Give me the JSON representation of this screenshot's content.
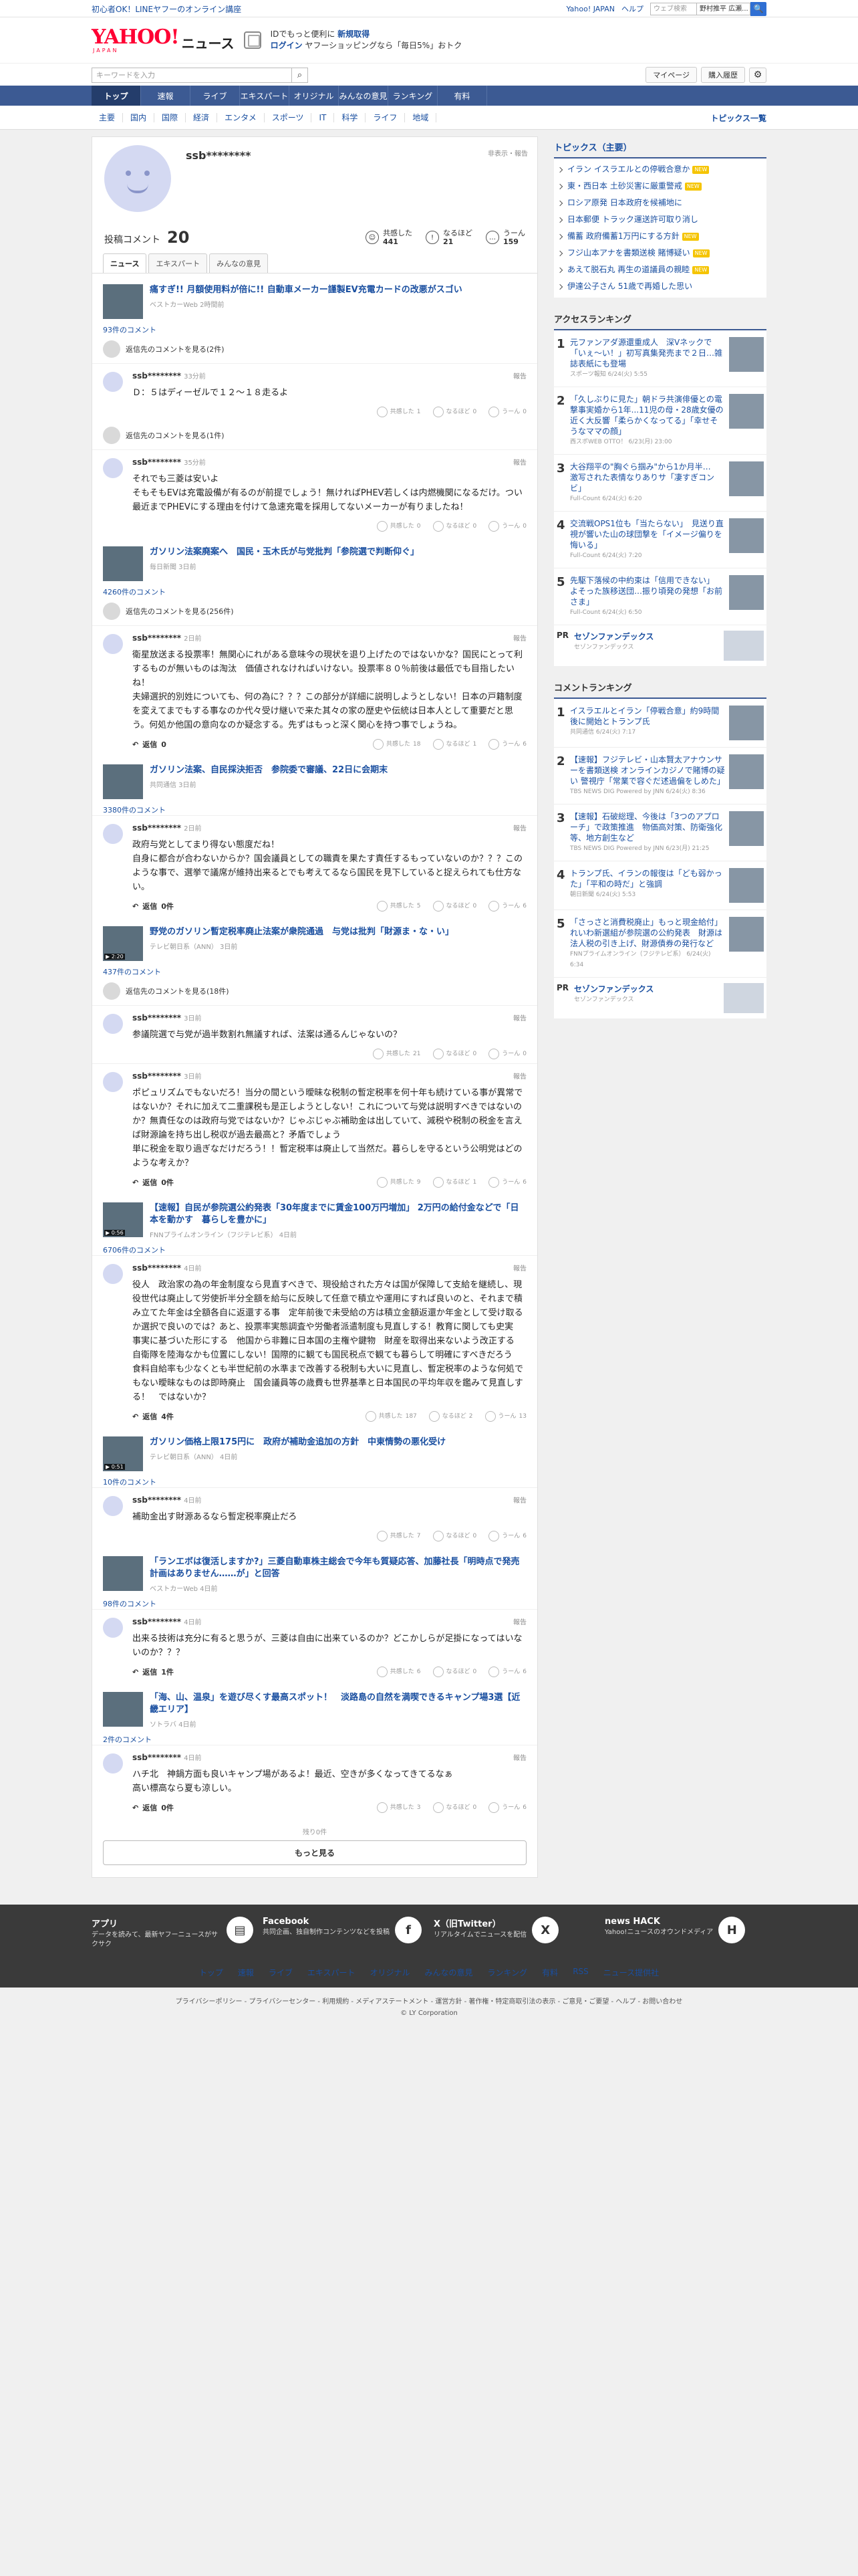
{
  "topbar": {
    "promo": "初心者OK！LINEヤフーのオンライン講座",
    "yahoo": "Yahoo! JAPAN",
    "help": "ヘルプ",
    "search_ph": "ウェブ検索",
    "loc": "野村推平 広瀬...",
    "btn": "🔍"
  },
  "header": {
    "logo": "YAHOO!",
    "logo_sub": "JAPAN",
    "service": "ニュース",
    "login_line1a": "IDでもっと便利に",
    "login_line1b": "新規取得",
    "login": "ログイン",
    "login_line2": "ヤフーショッピングなら「毎日5%」おトク"
  },
  "search": {
    "placeholder": "キーワードを入力",
    "mypage": "マイページ",
    "purchase": "購入履歴"
  },
  "gnav": [
    "トップ",
    "速報",
    "ライブ",
    "エキスパート",
    "オリジナル",
    "みんなの意見",
    "ランキング",
    "有料"
  ],
  "cnav": {
    "items": [
      "主要",
      "国内",
      "国際",
      "経済",
      "エンタメ",
      "スポーツ",
      "IT",
      "科学",
      "ライフ",
      "地域"
    ],
    "topics": "トピックス一覧"
  },
  "profile": {
    "name": "ssb********",
    "badge": "非表示・報告",
    "comment_label": "投稿コメント",
    "comment_count": "20",
    "r1": "共感した",
    "r1v": "441",
    "r2": "なるほど",
    "r2v": "21",
    "r3": "うーん",
    "r3v": "159"
  },
  "tabs": [
    "ニュース",
    "エキスパート",
    "みんなの意見"
  ],
  "ui": {
    "reply": "返信",
    "report": "報告",
    "empathy": "共感した",
    "naruhodo": "なるほど",
    "un": "うーん",
    "remaining": "残り0件",
    "more": "もっと見る"
  },
  "articles": [
    {
      "title": "痛すぎ!! 月額使用料が倍に!! 自動車メーカー謹製EV充電カードの改悪がスゴい",
      "src": "ベストカーWeb 2時間前",
      "count": "93件のコメント",
      "reply1": "返信先のコメントを見る(2件)",
      "comments": [
        {
          "user": "ssb********",
          "time": "33分前",
          "text": "Ｄ：５はディーゼルで１２～１８走るよ",
          "a": "1",
          "b": "0",
          "c": "0",
          "rep": ""
        }
      ],
      "reply2": "返信先のコメントを見る(1件)",
      "comments2": [
        {
          "user": "ssb********",
          "time": "35分前",
          "text": "それでも三菱は安いよ\nそもそもEVは充電設備が有るのが前提でしょう！無ければPHEV若しくは内燃機関になるだけ。つい最近までPHEVにする理由を付けて急速充電を採用してないメーカーが有りましたね！",
          "a": "0",
          "b": "0",
          "c": "0",
          "rep": ""
        }
      ]
    },
    {
      "title": "ガソリン法案廃案へ　国民・玉木氏が与党批判「参院選で判断仰ぐ」",
      "src": "毎日新聞 3日前",
      "count": "4260件のコメント",
      "reply1": "返信先のコメントを見る(256件)",
      "comments": [
        {
          "user": "ssb********",
          "time": "2日前",
          "text": "衛星放送まる投票率！無関心にれがある意味今の現状を退り上げたのではないかな？国民にとって利するものが無いものは淘汰　価値されなければいけない。投票率８０％前後は最低でも目指したいね！\n夫婦選択的別姓についても、何の為に？？？この部分が詳細に説明しようとしない！日本の戸籍制度を変えてまでもする事なのか代々受け継いで来た其々の家の歴史や伝統は日本人として重要だと思う。何処か他国の意向なのか疑念する。先ずはもっと深く関心を持つ事でしょうね。",
          "a": "18",
          "b": "1",
          "c": "6",
          "rep": "0"
        }
      ]
    },
    {
      "title": "ガソリン法案、自民採決拒否　参院委で審議、22日に会期末",
      "src": "共同通信 3日前",
      "count": "3380件のコメント",
      "comments": [
        {
          "user": "ssb********",
          "time": "2日前",
          "text": "政府与党としてまり得ない態度だね！\n自身に都合が合わないからか？国会議員としての職責を果たす責任するもっていないのか？？？このような事で、選挙で議席が維持出来るとでも考えてるなら国民を見下していると捉えられても仕方ない。",
          "a": "5",
          "b": "0",
          "c": "6",
          "rep": "0件"
        }
      ]
    },
    {
      "title": "野党のガソリン暫定税率廃止法案が衆院通過　与党は批判「財源ま・な・い」",
      "src": "テレビ朝日系（ANN） 3日前",
      "count": "437件のコメント",
      "reply1": "返信先のコメントを見る(18件)",
      "dur": "▶ 2:20",
      "comments": [
        {
          "user": "ssb********",
          "time": "3日前",
          "text": "参議院選で与党が過半数割れ無議すれば、法案は通るんじゃないの？",
          "a": "21",
          "b": "0",
          "c": "0",
          "rep": ""
        },
        {
          "user": "ssb********",
          "time": "3日前",
          "text": "ポピュリズムでもないだろ！当分の間という曖昧な税制の暫定税率を何十年も続けている事が異常ではないか？それに加えて二重課税も是正しようとしない！これについて与党は説明すべきではないのか？無責任なのは政府与党ではないか？じゃぶじゃぶ補助金は出していて、減税や税制の税金を言えば財源論を持ち出し税収が過去最高と？矛盾でしょう\n単に税金を取り過ぎなだけだろう！！暫定税率は廃止して当然だ。暮らしを守るという公明党はどのような考えか？",
          "a": "9",
          "b": "1",
          "c": "6",
          "rep": "0件"
        }
      ]
    },
    {
      "title": "【速報】自民が参院選公約発表「30年度までに賃金100万円増加」 2万円の給付金などで「日本を動かす　暮らしを豊かに」",
      "src": "FNNプライムオンライン（フジテレビ系） 4日前",
      "count": "6706件のコメント",
      "dur": "▶ 0:56",
      "comments": [
        {
          "user": "ssb********",
          "time": "4日前",
          "text": "役人　政治家の為の年金制度なら見直すべきで、現役給された方々は国が保障して支給を継続し、現役世代は廃止して労使折半分全額を給与に反映して任意で積立や運用にすれば良いのと、それまで積み立てた年金は全額各自に返還する事　定年前後で未受給の方は積立金額返還か年金として受け取るか選択で良いのでは？あと、投票率実態調査や労働者派遣制度も見直しする！教育に関しても史実　事実に基づいた形にする　他国から非難に日本国の主権や鍵物　財産を取得出来ないよう改正する　自衛隊を陸海なかも位置にしない！国際的に観ても国民税点で観ても暮らして明確にすべきだろう　食料自給率も少なくとも半世紀前の水準まで改善する税制も大いに見直し、暫定税率のような何処でもない曖昧なものは即時廃止　国会議員等の歳費も世界基準と日本国民の平均年収を鑑みて見直しする！　ではないか？",
          "a": "187",
          "b": "2",
          "c": "13",
          "rep": "4件"
        }
      ]
    },
    {
      "title": "ガソリン価格上限175円に　政府が補助金追加の方針　中東情勢の悪化受け",
      "src": "テレビ朝日系（ANN） 4日前",
      "count": "10件のコメント",
      "dur": "▶ 0:51",
      "comments": [
        {
          "user": "ssb********",
          "time": "4日前",
          "text": "補助金出す財源あるなら暫定税率廃止だろ",
          "a": "7",
          "b": "0",
          "c": "6",
          "rep": ""
        }
      ]
    },
    {
      "title": "「ランエボは復活しますか?」三菱自動車株主総会で今年も質疑応答、加藤社長「明時点で発売計画はありません……が」と回答",
      "src": "ベストカーWeb 4日前",
      "count": "98件のコメント",
      "comments": [
        {
          "user": "ssb********",
          "time": "4日前",
          "text": "出来る技術は充分に有ると思うが、三菱は自由に出来ているのか？どこかしらが足掛になってはいないのか？？？",
          "a": "6",
          "b": "0",
          "c": "6",
          "rep": "1件"
        }
      ]
    },
    {
      "title": "「海、山、温泉」を遊び尽くす最高スポット！　淡路島の自然を満喫できるキャンプ場3選【近畿エリア】",
      "src": "ソトラバ 4日前",
      "count": "2件のコメント",
      "comments": [
        {
          "user": "ssb********",
          "time": "4日前",
          "text": "ハチ北　神鍋方面も良いキャンプ場があるよ！最近、空きが多くなってきてるなぁ\n高い標高なら夏も涼しい。",
          "a": "3",
          "b": "0",
          "c": "6",
          "rep": "0件"
        }
      ]
    }
  ],
  "side": {
    "topics_title": "トピックス（主要）",
    "topics": [
      "イラン イスラエルとの停戦合意か",
      "東・西日本 土砂災害に厳重警戒",
      "ロシア原発 日本政府を候補地に",
      "日本郵便 トラック運送許可取り消し",
      "備蓄 政府備蓄1万円にする方針",
      "フジ山本アナを書類送検 賭博疑い",
      "あえて脱石丸 再生の道議員の親睦",
      "伊達公子さん 51歳で再婚した思い"
    ],
    "access_title": "アクセスランキング",
    "access": [
      {
        "t": "元ファンアダ源還重成人　深Vネックで「いぇ〜い！」初写真集発売まで２日…雑誌表紙にも登場",
        "s": "スポーツ報知 6/24(火) 5:55"
      },
      {
        "t": "「久しぶりに見た」朝ドラ共演俳優との電撃事実婚から1年...11児の母・28歳女優の近く大反響「柔らかくなってる」「幸せそうなママの顔」",
        "s": "西スポWEB OTTO！ 6/23(月) 23:00"
      },
      {
        "t": "大谷翔平の\"胸ぐら掴み\"から1か月半…　激写された表情なりありサ「凄すぎコンビ」",
        "s": "Full-Count 6/24(火) 6:20"
      },
      {
        "t": "交流戦OPS1位も「当たらない」　見送り直視が響いた山の球団撃を「イメージ偏りを悔いる」",
        "s": "Full-Count 6/24(火) 7:20"
      },
      {
        "t": "先駆下落候の中約束は「信用できない」　よそった族移送団…振り頃発の発想「お前さま」",
        "s": "Full-Count 6/24(火) 6:50"
      }
    ],
    "pr1": {
      "t": "セゾンファンデックス",
      "s": "セゾンファンデックス"
    },
    "crank_title": "コメントランキング",
    "crank": [
      {
        "t": "イスラエルとイラン「停戦合意」約9時間後に開始とトランプ氏",
        "s": "共同通信 6/24(火) 7:17"
      },
      {
        "t": "【速報】フジテレビ・山本賢太アナウンサーを書類送検 オンラインカジノで賭博の疑い 警視庁「常業で容ぐだ述過偏をしめた」",
        "s": "TBS NEWS DIG Powered by JNN 6/24(火) 8:36"
      },
      {
        "t": "【速報】石破総理、今後は「3つのアプローチ」で政策推進　物価高対策、防衛強化等、地方創生など",
        "s": "TBS NEWS DIG Powered by JNN 6/23(月) 21:25"
      },
      {
        "t": "トランプ氏、イランの報復は「ども弱かった」「平和の時だ」と強調",
        "s": "朝日新聞 6/24(火) 5:53"
      },
      {
        "t": "「さっさと消費税廃止」もっと現金給付」れいわ新選組が参院選の公約発表　財源は法人税の引き上げ、財源債券の発行など",
        "s": "FNNプライムオンライン（フジテレビ系） 6/24(火) 6:34"
      }
    ],
    "pr2": {
      "t": "セゾンファンデックス",
      "s": "セゾンファンデックス"
    }
  },
  "footer": {
    "apps": [
      {
        "t": "アプリ",
        "d": "データを読みて、最新ヤフーニュースがサクサク"
      },
      {
        "t": "Facebook",
        "d": "共同企画、独自制作コンテンツなどを投稿"
      },
      {
        "t": "X（旧Twitter）",
        "d": "リアルタイムでニュースを配信"
      },
      {
        "t": "news HACK",
        "d": "Yahoo!ニュースのオウンドメディア"
      }
    ],
    "nav": [
      "トップ",
      "速報",
      "ライブ",
      "エキスパート",
      "オリジナル",
      "みんなの意見",
      "ランキング",
      "有料",
      "RSS",
      "ニュース提供社"
    ],
    "legal": "プライバシーポリシー - プライバシーセンター - 利用規約 - メディアステートメント - 運営方針 - 著作権・特定商取引法の表示 - ご意見・ご要望 - ヘルプ - お問い合わせ",
    "copy": "© LY Corporation"
  }
}
